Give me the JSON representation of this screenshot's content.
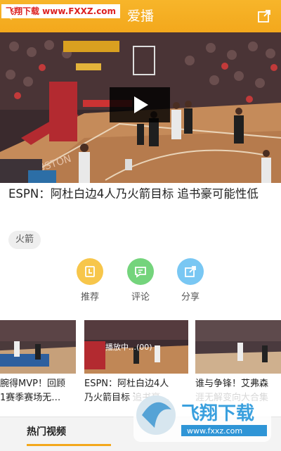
{
  "header": {
    "title": "爱播",
    "watermark": "飞翔下载 www.FXXZ.com",
    "share_icon": "share-icon",
    "back_icon": "back-icon"
  },
  "video": {
    "play_icon": "play-icon"
  },
  "article": {
    "headline": "ESPN：阿杜白边4人乃火箭目标 追书豪可能性低",
    "tag": "火箭"
  },
  "actions": [
    {
      "label": "推荐",
      "icon": "recommend-icon",
      "color": "#f7c64b"
    },
    {
      "label": "评论",
      "icon": "comment-icon",
      "color": "#74d47c"
    },
    {
      "label": "分享",
      "icon": "share-icon",
      "color": "#79c7f3"
    }
  ],
  "related": [
    {
      "text": "腕得MVP！回顾\n1赛季赛场无…"
    },
    {
      "text": "ESPN：阿杜白边4人\n乃火箭目标 追书豪…",
      "badge": "播放中…(00)"
    },
    {
      "text": "谁与争锋！艾弗森\n涯无解变向大合集"
    }
  ],
  "bottom_tabs": {
    "active": "热门视频"
  },
  "logo_watermark": {
    "brand": "飞翔下载",
    "url": "www.fxxz.com"
  }
}
